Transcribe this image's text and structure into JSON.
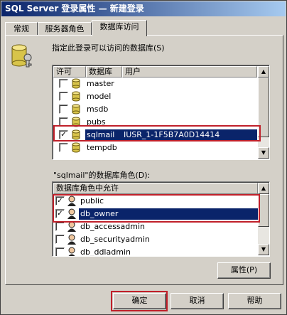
{
  "window": {
    "title": "SQL Server 登录属性 — 新建登录"
  },
  "tabs": [
    {
      "label": "常规",
      "active": false
    },
    {
      "label": "服务器角色",
      "active": false
    },
    {
      "label": "数据库访问",
      "active": true
    }
  ],
  "db_access": {
    "instruction": "指定此登录可以访问的数据库(S)",
    "columns": [
      "许可",
      "数据库",
      "用户"
    ],
    "rows": [
      {
        "checked": false,
        "database": "master",
        "user": ""
      },
      {
        "checked": false,
        "database": "model",
        "user": ""
      },
      {
        "checked": false,
        "database": "msdb",
        "user": ""
      },
      {
        "checked": false,
        "database": "pubs",
        "user": ""
      },
      {
        "checked": true,
        "database": "sqlmail",
        "user": "IUSR_1-1F5B7A0D14414",
        "selected": true
      },
      {
        "checked": false,
        "database": "tempdb",
        "user": ""
      }
    ]
  },
  "roles": {
    "label": "\"sqlmail\"的数据库角色(D):",
    "column": "数据库角色中允许",
    "rows": [
      {
        "checked": true,
        "name": "public"
      },
      {
        "checked": true,
        "name": "db_owner",
        "selected": true
      },
      {
        "checked": false,
        "name": "db_accessadmin"
      },
      {
        "checked": false,
        "name": "db_securityadmin"
      },
      {
        "checked": false,
        "name": "db_ddladmin"
      }
    ],
    "properties_button": "属性(P)"
  },
  "buttons": {
    "ok": "确定",
    "cancel": "取消",
    "help": "帮助"
  },
  "colors": {
    "selection": "#0a246a",
    "highlight_box": "#c0202a",
    "face": "#d4d0c8"
  }
}
